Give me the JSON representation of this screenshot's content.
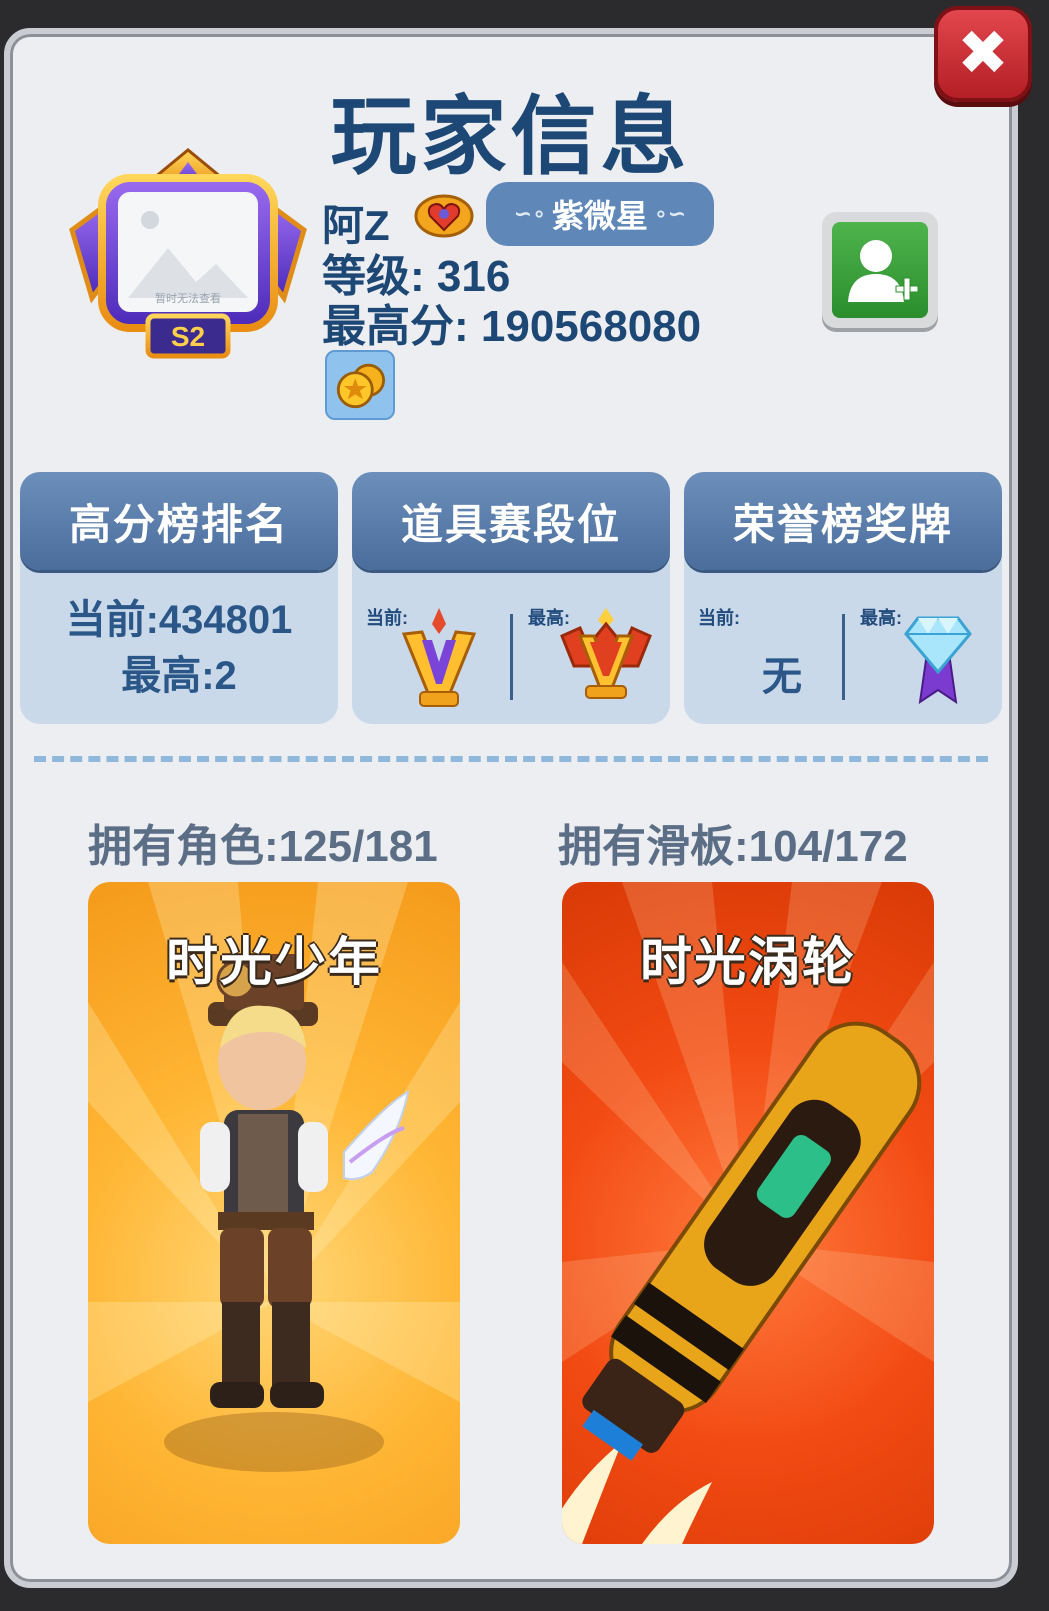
{
  "dialog": {
    "title": "玩家信息",
    "close_icon": "close-icon"
  },
  "avatar": {
    "placeholder_text": "暂时无法查看",
    "season_badge": "S2",
    "frame_icon": "purple-crown-frame"
  },
  "player": {
    "name": "阿Z",
    "vip_icon": "vip-heart-badge-icon",
    "title_tag": "紫微星",
    "level_label": "等级:",
    "level": "316",
    "best_score_label": "最高分:",
    "best_score": "190568080",
    "coin_badge_icon": "coin-badge-icon",
    "add_friend_icon": "add-friend-icon"
  },
  "cards": [
    {
      "title": "高分榜排名",
      "current_line": "当前:434801",
      "best_line": "最高:2"
    },
    {
      "title": "道具赛段位",
      "current_label": "当前:",
      "best_label": "最高:",
      "current_icon": "purple-v-rank-icon",
      "best_icon": "red-v-rank-icon"
    },
    {
      "title": "荣誉榜奖牌",
      "current_label": "当前:",
      "current_value": "无",
      "best_label": "最高:",
      "best_icon": "diamond-medal-icon"
    }
  ],
  "collection": {
    "characters_label": "拥有角色:125/181",
    "boards_label": "拥有滑板:104/172",
    "character_name": "时光少年",
    "board_name": "时光涡轮"
  },
  "colors": {
    "title": "#1d4775",
    "card_header": "#5a7dab",
    "card_body": "#c9d9ea",
    "close_red": "#c9262d",
    "add_green": "#3aa23a",
    "character_bg": "#ffb634",
    "board_bg": "#f24a13"
  }
}
